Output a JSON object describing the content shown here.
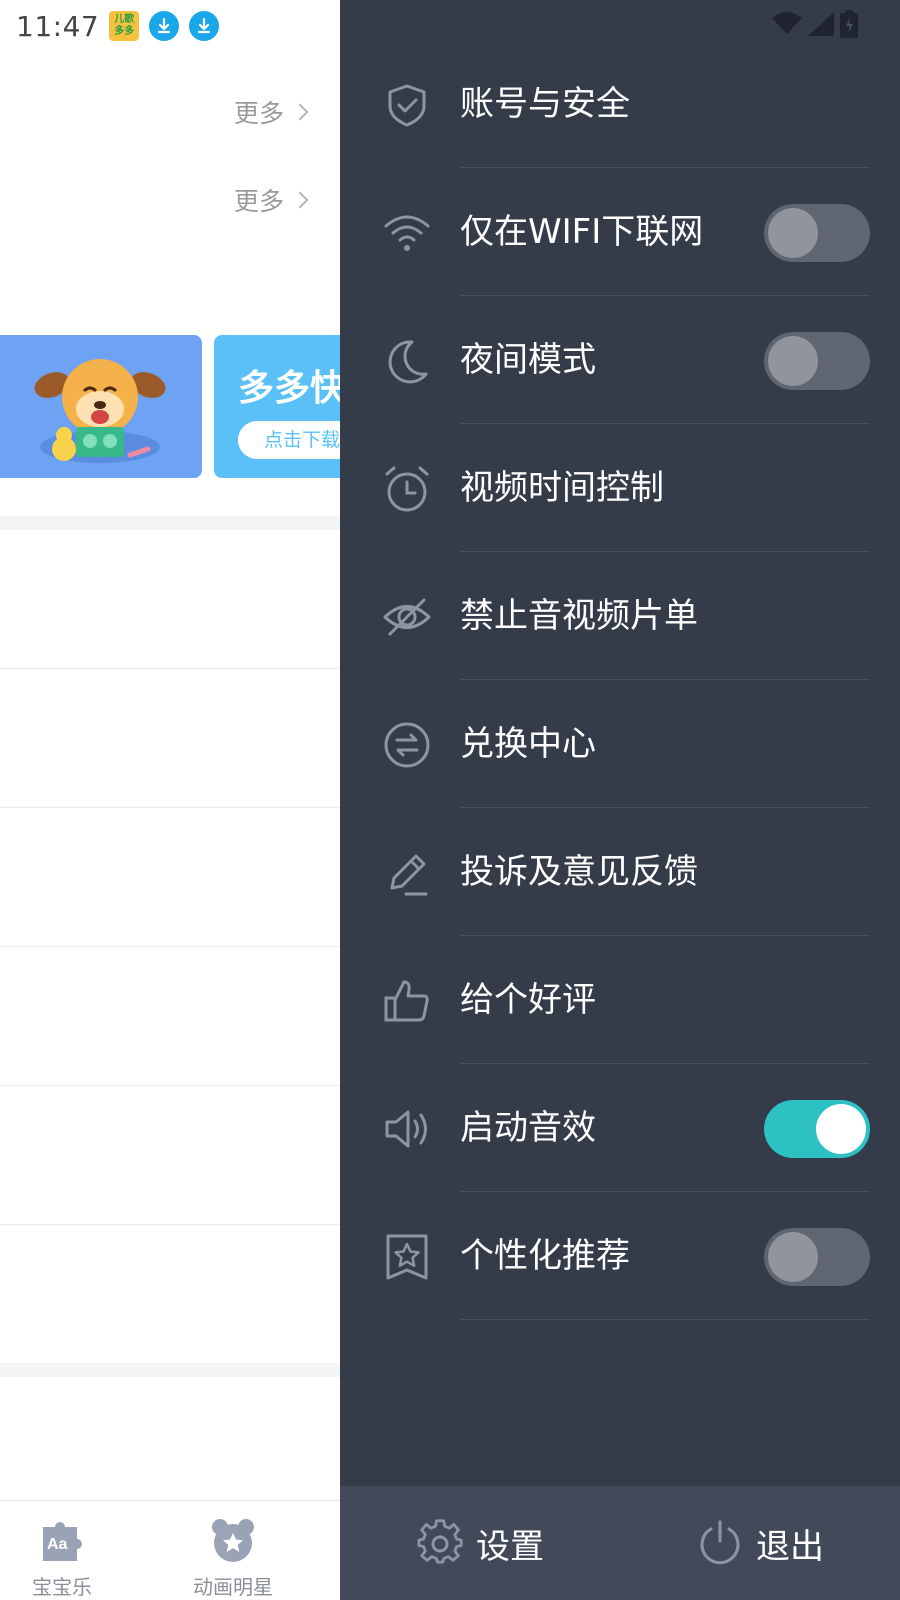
{
  "status_bar": {
    "time": "11:47",
    "app_badge_text": "儿歌多多",
    "icons": [
      "kids-app-icon",
      "download-icon",
      "download-icon",
      "wifi-icon",
      "signal-icon",
      "battery-icon"
    ]
  },
  "background": {
    "section_more": [
      "更多",
      "更多"
    ],
    "banner_title": "多多快",
    "banner_button": "点击下载"
  },
  "bottom_nav": {
    "items": [
      {
        "label": "宝宝乐",
        "icon": "puzzle-aa-icon"
      },
      {
        "label": "动画明星",
        "icon": "bear-star-icon"
      }
    ]
  },
  "drawer": {
    "menu": [
      {
        "label": "账号与安全",
        "icon": "shield-check-icon"
      },
      {
        "label": "仅在WIFI下联网",
        "icon": "wifi-icon",
        "toggle": false
      },
      {
        "label": "夜间模式",
        "icon": "moon-icon",
        "toggle": false
      },
      {
        "label": "视频时间控制",
        "icon": "alarm-clock-icon"
      },
      {
        "label": "禁止音视频片单",
        "icon": "eye-off-icon"
      },
      {
        "label": "兑换中心",
        "icon": "exchange-icon"
      },
      {
        "label": "投诉及意见反馈",
        "icon": "pencil-icon"
      },
      {
        "label": "给个好评",
        "icon": "thumbs-up-icon"
      },
      {
        "label": "启动音效",
        "icon": "speaker-icon",
        "toggle": true
      },
      {
        "label": "个性化推荐",
        "icon": "bookmark-star-icon",
        "toggle": false
      }
    ],
    "footer": {
      "settings_label": "设置",
      "logout_label": "退出"
    }
  },
  "colors": {
    "drawer_bg": "#343b49",
    "drawer_footer_bg": "#424a59",
    "toggle_on": "#2ec1c3",
    "toggle_off": "#5f6571",
    "banner_blue": "#6ea2f2",
    "banner_sky": "#5ac0f7"
  }
}
